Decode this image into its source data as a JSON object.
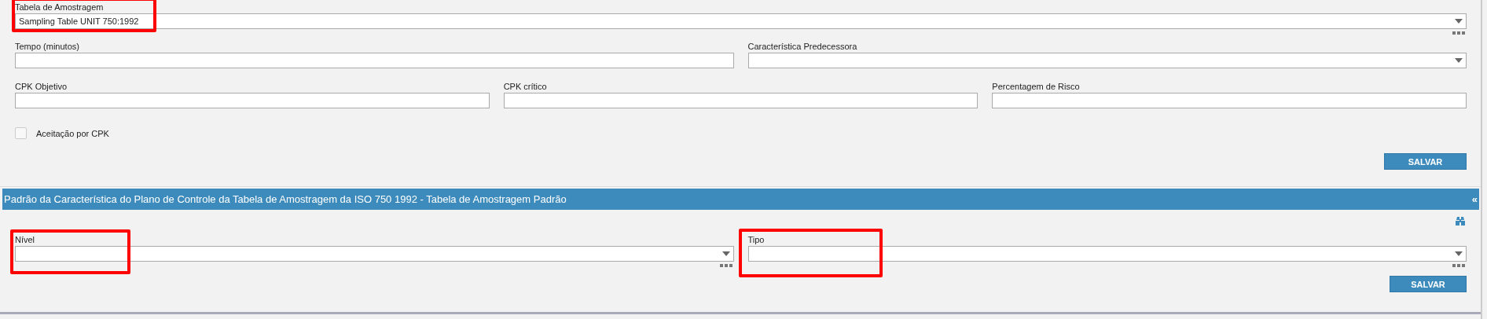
{
  "top_form": {
    "sampling_table": {
      "label": "Tabela de Amostragem",
      "value": "Sampling Table UNIT 750:1992",
      "highlighted": true
    },
    "time": {
      "label": "Tempo (minutos)"
    },
    "predecessor": {
      "label": "Característica Predecessora"
    },
    "cpk_target": {
      "label": "CPK Objetivo"
    },
    "cpk_critical": {
      "label": "CPK crítico"
    },
    "risk_percentage": {
      "label": "Percentagem de Risco"
    },
    "cpk_acceptance": {
      "label": "Aceitação por CPK",
      "checked": false
    },
    "save_button": "SALVAR"
  },
  "section": {
    "title": "Padrão da Característica do Plano de Controle da Tabela de Amostragem da ISO 750 1992 - Tabela de Amostragem Padrão",
    "collapse": "«",
    "level": {
      "label": "Nível",
      "highlighted": true
    },
    "type": {
      "label": "Tipo",
      "highlighted": true
    },
    "save_button": "SALVAR"
  }
}
